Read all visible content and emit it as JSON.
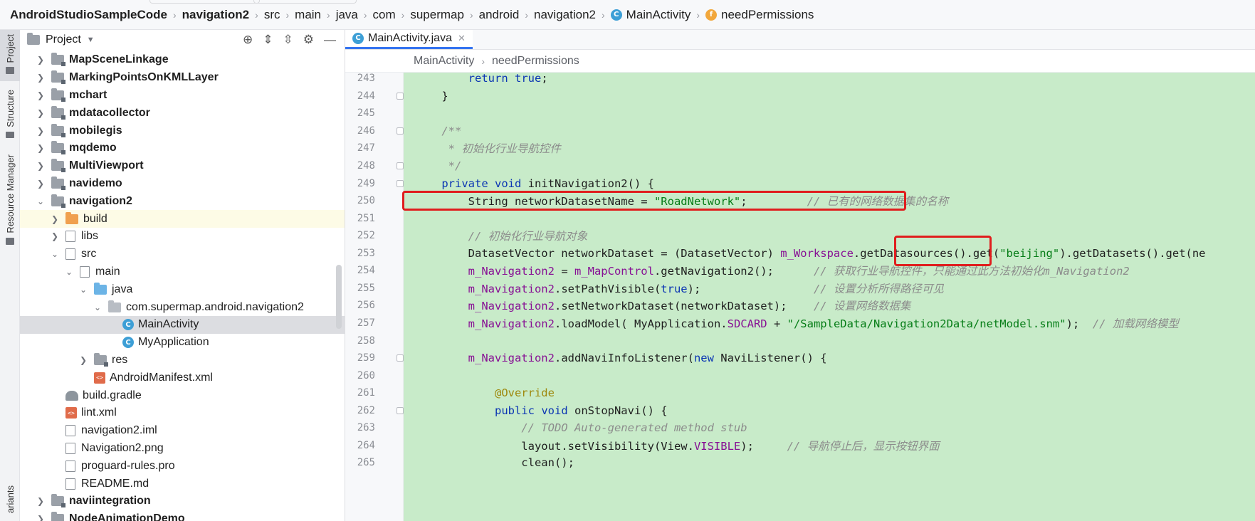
{
  "navbar": {
    "crumbs": [
      {
        "label": "AndroidStudioSampleCode",
        "bold": true
      },
      {
        "label": "navigation2",
        "bold": true
      },
      {
        "label": "src"
      },
      {
        "label": "main"
      },
      {
        "label": "java"
      },
      {
        "label": "com"
      },
      {
        "label": "supermap"
      },
      {
        "label": "android"
      },
      {
        "label": "navigation2"
      },
      {
        "label": "MainActivity",
        "icon": "class-icon"
      },
      {
        "label": "needPermissions",
        "icon": "method-icon"
      }
    ]
  },
  "toolstrip": {
    "tabs": [
      "Project",
      "Structure",
      "Resource Manager",
      "ariants"
    ]
  },
  "project": {
    "title": "Project",
    "tree": [
      {
        "label": "MapSceneLinkage",
        "indent": 0,
        "chevron": "right",
        "icon": "module",
        "bold": true
      },
      {
        "label": "MarkingPointsOnKMLLayer",
        "indent": 0,
        "chevron": "right",
        "icon": "module",
        "bold": true
      },
      {
        "label": "mchart",
        "indent": 0,
        "chevron": "right",
        "icon": "module",
        "bold": true
      },
      {
        "label": "mdatacollector",
        "indent": 0,
        "chevron": "right",
        "icon": "module",
        "bold": true
      },
      {
        "label": "mobilegis",
        "indent": 0,
        "chevron": "right",
        "icon": "module",
        "bold": true
      },
      {
        "label": "mqdemo",
        "indent": 0,
        "chevron": "right",
        "icon": "module",
        "bold": true
      },
      {
        "label": "MultiViewport",
        "indent": 0,
        "chevron": "right",
        "icon": "module",
        "bold": true
      },
      {
        "label": "navidemo",
        "indent": 0,
        "chevron": "right",
        "icon": "module",
        "bold": true
      },
      {
        "label": "navigation2",
        "indent": 0,
        "chevron": "down",
        "icon": "module",
        "bold": true
      },
      {
        "label": "build",
        "indent": 1,
        "chevron": "right",
        "icon": "folder-orange",
        "highlight": "yellow"
      },
      {
        "label": "libs",
        "indent": 1,
        "chevron": "right",
        "icon": "folder"
      },
      {
        "label": "src",
        "indent": 1,
        "chevron": "down",
        "icon": "folder"
      },
      {
        "label": "main",
        "indent": 2,
        "chevron": "down",
        "icon": "folder"
      },
      {
        "label": "java",
        "indent": 3,
        "chevron": "down",
        "icon": "folder-blue"
      },
      {
        "label": "com.supermap.android.navigation2",
        "indent": 4,
        "chevron": "down",
        "icon": "package"
      },
      {
        "label": "MainActivity",
        "indent": 5,
        "chevron": "",
        "icon": "class",
        "highlight": "gray"
      },
      {
        "label": "MyApplication",
        "indent": 5,
        "chevron": "",
        "icon": "class"
      },
      {
        "label": "res",
        "indent": 3,
        "chevron": "right",
        "icon": "folder-res"
      },
      {
        "label": "AndroidManifest.xml",
        "indent": 3,
        "chevron": "",
        "icon": "xml"
      },
      {
        "label": "build.gradle",
        "indent": 1,
        "chevron": "",
        "icon": "gradle"
      },
      {
        "label": "lint.xml",
        "indent": 1,
        "chevron": "",
        "icon": "xml"
      },
      {
        "label": "navigation2.iml",
        "indent": 1,
        "chevron": "",
        "icon": "file"
      },
      {
        "label": "Navigation2.png",
        "indent": 1,
        "chevron": "",
        "icon": "file"
      },
      {
        "label": "proguard-rules.pro",
        "indent": 1,
        "chevron": "",
        "icon": "file"
      },
      {
        "label": "README.md",
        "indent": 1,
        "chevron": "",
        "icon": "file"
      },
      {
        "label": "naviintegration",
        "indent": 0,
        "chevron": "right",
        "icon": "module",
        "bold": true
      },
      {
        "label": "NodeAnimationDemo",
        "indent": 0,
        "chevron": "right",
        "icon": "module",
        "bold": true
      }
    ]
  },
  "editor": {
    "tab_label": "MainActivity.java",
    "breadcrumb": [
      "MainActivity",
      "needPermissions"
    ],
    "lines": [
      {
        "n": "243",
        "tokens": [
          [
            "        ",
            ""
          ],
          [
            "return",
            "kw"
          ],
          [
            " ",
            ""
          ],
          [
            "true",
            "kw"
          ],
          [
            ";",
            ""
          ]
        ]
      },
      {
        "n": "244",
        "tokens": [
          [
            "    }",
            ""
          ]
        ]
      },
      {
        "n": "245",
        "tokens": []
      },
      {
        "n": "246",
        "tokens": [
          [
            "    /**",
            "cmt"
          ]
        ]
      },
      {
        "n": "247",
        "tokens": [
          [
            "     * 初始化行业导航控件",
            "cmt"
          ]
        ]
      },
      {
        "n": "248",
        "tokens": [
          [
            "     */",
            "cmt"
          ]
        ]
      },
      {
        "n": "249",
        "tokens": [
          [
            "    ",
            ""
          ],
          [
            "private",
            "kw"
          ],
          [
            " ",
            ""
          ],
          [
            "void",
            "kw"
          ],
          [
            " initNavigation2() {",
            ""
          ]
        ]
      },
      {
        "n": "250",
        "tokens": [
          [
            "        String networkDatasetName = ",
            ""
          ],
          [
            "\"RoadNetwork\"",
            "str"
          ],
          [
            ";         ",
            ""
          ],
          [
            "// 已有的网络数据集的名称",
            "cmt"
          ]
        ]
      },
      {
        "n": "251",
        "tokens": []
      },
      {
        "n": "252",
        "tokens": [
          [
            "        ",
            ""
          ],
          [
            "// 初始化行业导航对象",
            "cmt"
          ]
        ]
      },
      {
        "n": "253",
        "tokens": [
          [
            "        DatasetVector networkDataset = (DatasetVector) ",
            ""
          ],
          [
            "m_Workspace",
            "fld"
          ],
          [
            ".getDatasources().get(",
            ""
          ],
          [
            "\"beijing\"",
            "str"
          ],
          [
            ").getDatasets().get(ne",
            ""
          ]
        ]
      },
      {
        "n": "254",
        "tokens": [
          [
            "        ",
            ""
          ],
          [
            "m_Navigation2",
            "fld"
          ],
          [
            " = ",
            ""
          ],
          [
            "m_MapControl",
            "fld"
          ],
          [
            ".getNavigation2();      ",
            ""
          ],
          [
            "// 获取行业导航控件，只能通过此方法初始化m_Navigation2",
            "cmt"
          ]
        ]
      },
      {
        "n": "255",
        "tokens": [
          [
            "        ",
            ""
          ],
          [
            "m_Navigation2",
            "fld"
          ],
          [
            ".setPathVisible(",
            ""
          ],
          [
            "true",
            "kw"
          ],
          [
            ");                 ",
            ""
          ],
          [
            "// 设置分析所得路径可见",
            "cmt"
          ]
        ]
      },
      {
        "n": "256",
        "tokens": [
          [
            "        ",
            ""
          ],
          [
            "m_Navigation2",
            "fld"
          ],
          [
            ".setNetworkDataset(networkDataset);    ",
            ""
          ],
          [
            "// 设置网络数据集",
            "cmt"
          ]
        ]
      },
      {
        "n": "257",
        "tokens": [
          [
            "        ",
            ""
          ],
          [
            "m_Navigation2",
            "fld"
          ],
          [
            ".loadModel( MyApplication.",
            ""
          ],
          [
            "SDCARD",
            "fld"
          ],
          [
            " + ",
            ""
          ],
          [
            "\"/SampleData/Navigation2Data/netModel.snm\"",
            "str"
          ],
          [
            ");  ",
            ""
          ],
          [
            "// 加载网络模型",
            "cmt"
          ]
        ]
      },
      {
        "n": "258",
        "tokens": []
      },
      {
        "n": "259",
        "tokens": [
          [
            "        ",
            ""
          ],
          [
            "m_Navigation2",
            "fld"
          ],
          [
            ".addNaviInfoListener(",
            ""
          ],
          [
            "new",
            "kw"
          ],
          [
            " NaviListener() {",
            ""
          ]
        ]
      },
      {
        "n": "260",
        "tokens": []
      },
      {
        "n": "261",
        "tokens": [
          [
            "            ",
            ""
          ],
          [
            "@Override",
            "ann"
          ]
        ]
      },
      {
        "n": "262",
        "tokens": [
          [
            "            ",
            ""
          ],
          [
            "public",
            "kw"
          ],
          [
            " ",
            ""
          ],
          [
            "void",
            "kw"
          ],
          [
            " onStopNavi() {",
            ""
          ]
        ]
      },
      {
        "n": "263",
        "tokens": [
          [
            "                ",
            ""
          ],
          [
            "// TODO Auto-generated method stub",
            "cmt"
          ]
        ]
      },
      {
        "n": "264",
        "tokens": [
          [
            "                layout.setVisibility(View.",
            ""
          ],
          [
            "VISIBLE",
            "fld"
          ],
          [
            ");     ",
            ""
          ],
          [
            "// 导航停止后，显示按钮界面",
            "cmt"
          ]
        ]
      },
      {
        "n": "265",
        "tokens": [
          [
            "                clean();",
            ""
          ]
        ]
      }
    ]
  }
}
